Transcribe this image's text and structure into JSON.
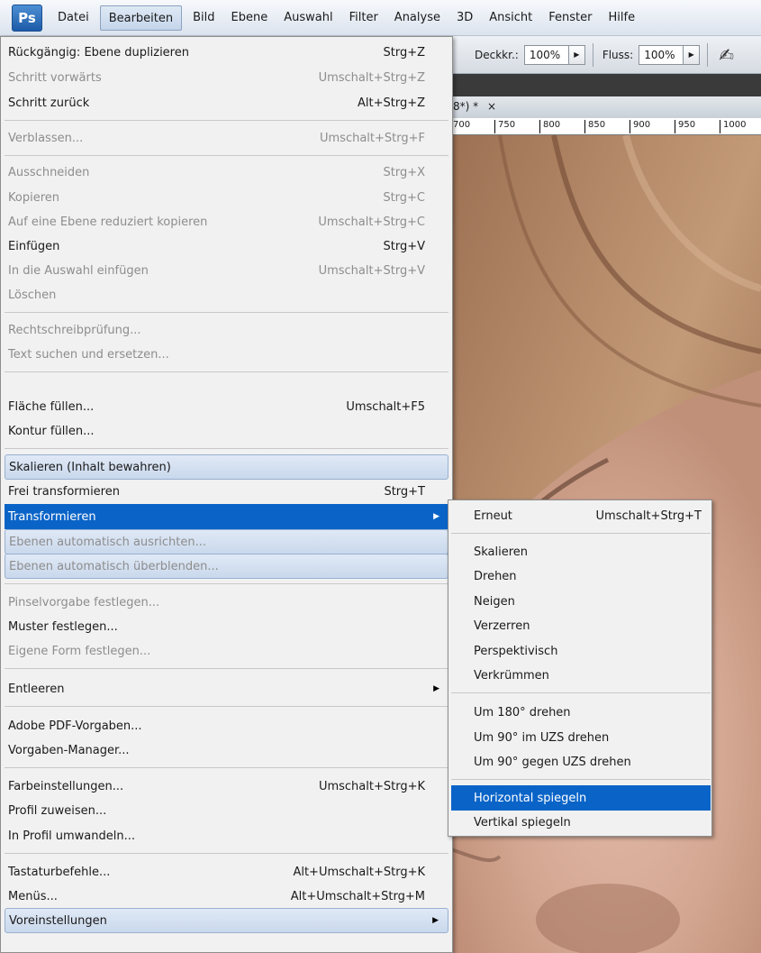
{
  "app": {
    "logo": "Ps"
  },
  "menubar": [
    {
      "label": "Datei"
    },
    {
      "label": "Bearbeiten"
    },
    {
      "label": "Bild"
    },
    {
      "label": "Ebene"
    },
    {
      "label": "Auswahl"
    },
    {
      "label": "Filter"
    },
    {
      "label": "Analyse"
    },
    {
      "label": "3D"
    },
    {
      "label": "Ansicht"
    },
    {
      "label": "Fenster"
    },
    {
      "label": "Hilfe"
    }
  ],
  "options": {
    "opacity_label": "Deckkr.:",
    "opacity_value": "100%",
    "flow_label": "Fluss:",
    "flow_value": "100%",
    "arrow_glyph": "▶"
  },
  "doc_tab": {
    "title": "8*) *",
    "close": "×"
  },
  "ruler": {
    "ticks": [
      "700",
      "750",
      "800",
      "850",
      "900",
      "950",
      "1000"
    ]
  },
  "menu": [
    {
      "label": "Rückgängig: Ebene duplizieren",
      "shortcut": "Strg+Z",
      "disabled": false
    },
    {
      "label": "Schritt vorwärts",
      "shortcut": "Umschalt+Strg+Z",
      "disabled": true
    },
    {
      "label": "Schritt zurück",
      "shortcut": "Alt+Strg+Z",
      "disabled": false
    },
    {
      "label": "Verblassen...",
      "shortcut": "Umschalt+Strg+F",
      "disabled": true
    },
    {
      "label": "Ausschneiden",
      "shortcut": "Strg+X",
      "disabled": true
    },
    {
      "label": "Kopieren",
      "shortcut": "Strg+C",
      "disabled": true
    },
    {
      "label": "Auf eine Ebene reduziert kopieren",
      "shortcut": "Umschalt+Strg+C",
      "disabled": true
    },
    {
      "label": "Einfügen",
      "shortcut": "Strg+V",
      "disabled": false
    },
    {
      "label": "In die Auswahl einfügen",
      "shortcut": "Umschalt+Strg+V",
      "disabled": true
    },
    {
      "label": "Löschen",
      "shortcut": "",
      "disabled": true
    },
    {
      "label": "Rechtschreibprüfung...",
      "shortcut": "",
      "disabled": true
    },
    {
      "label": "Text suchen und ersetzen...",
      "shortcut": "",
      "disabled": true
    },
    {
      "label": "Fläche füllen...",
      "shortcut": "Umschalt+F5",
      "disabled": false
    },
    {
      "label": "Kontur füllen...",
      "shortcut": "",
      "disabled": false
    },
    {
      "label": "Skalieren (Inhalt bewahren)",
      "shortcut": "",
      "disabled": false
    },
    {
      "label": "Frei transformieren",
      "shortcut": "Strg+T",
      "disabled": false
    },
    {
      "label": "Transformieren",
      "shortcut": "",
      "disabled": false
    },
    {
      "label": "Ebenen automatisch ausrichten...",
      "shortcut": "",
      "disabled": true
    },
    {
      "label": "Ebenen automatisch überblenden...",
      "shortcut": "",
      "disabled": true
    },
    {
      "label": "Pinselvorgabe festlegen...",
      "shortcut": "",
      "disabled": true
    },
    {
      "label": "Muster festlegen...",
      "shortcut": "",
      "disabled": false
    },
    {
      "label": "Eigene Form festlegen...",
      "shortcut": "",
      "disabled": true
    },
    {
      "label": "Entleeren",
      "shortcut": "",
      "disabled": false
    },
    {
      "label": "Adobe PDF-Vorgaben...",
      "shortcut": "",
      "disabled": false
    },
    {
      "label": "Vorgaben-Manager...",
      "shortcut": "",
      "disabled": false
    },
    {
      "label": "Farbeinstellungen...",
      "shortcut": "Umschalt+Strg+K",
      "disabled": false
    },
    {
      "label": "Profil zuweisen...",
      "shortcut": "",
      "disabled": false
    },
    {
      "label": "In Profil umwandeln...",
      "shortcut": "",
      "disabled": false
    },
    {
      "label": "Tastaturbefehle...",
      "shortcut": "Alt+Umschalt+Strg+K",
      "disabled": false
    },
    {
      "label": "Menüs...",
      "shortcut": "Alt+Umschalt+Strg+M",
      "disabled": false
    },
    {
      "label": "Voreinstellungen",
      "shortcut": "",
      "disabled": false
    }
  ],
  "submenu": [
    {
      "label": "Erneut",
      "shortcut": "Umschalt+Strg+T"
    },
    {
      "label": "Skalieren",
      "shortcut": ""
    },
    {
      "label": "Drehen",
      "shortcut": ""
    },
    {
      "label": "Neigen",
      "shortcut": ""
    },
    {
      "label": "Verzerren",
      "shortcut": ""
    },
    {
      "label": "Perspektivisch",
      "shortcut": ""
    },
    {
      "label": "Verkrümmen",
      "shortcut": ""
    },
    {
      "label": "Um 180° drehen",
      "shortcut": ""
    },
    {
      "label": "Um 90° im UZS drehen",
      "shortcut": ""
    },
    {
      "label": "Um 90° gegen UZS drehen",
      "shortcut": ""
    },
    {
      "label": "Horizontal spiegeln",
      "shortcut": ""
    },
    {
      "label": "Vertikal spiegeln",
      "shortcut": ""
    }
  ],
  "submenu_arrow": "▶",
  "colors": {
    "highlight": "#0a64c8",
    "menu_bg": "#f1f1f1",
    "disabled_text": "#8d8d8d"
  }
}
